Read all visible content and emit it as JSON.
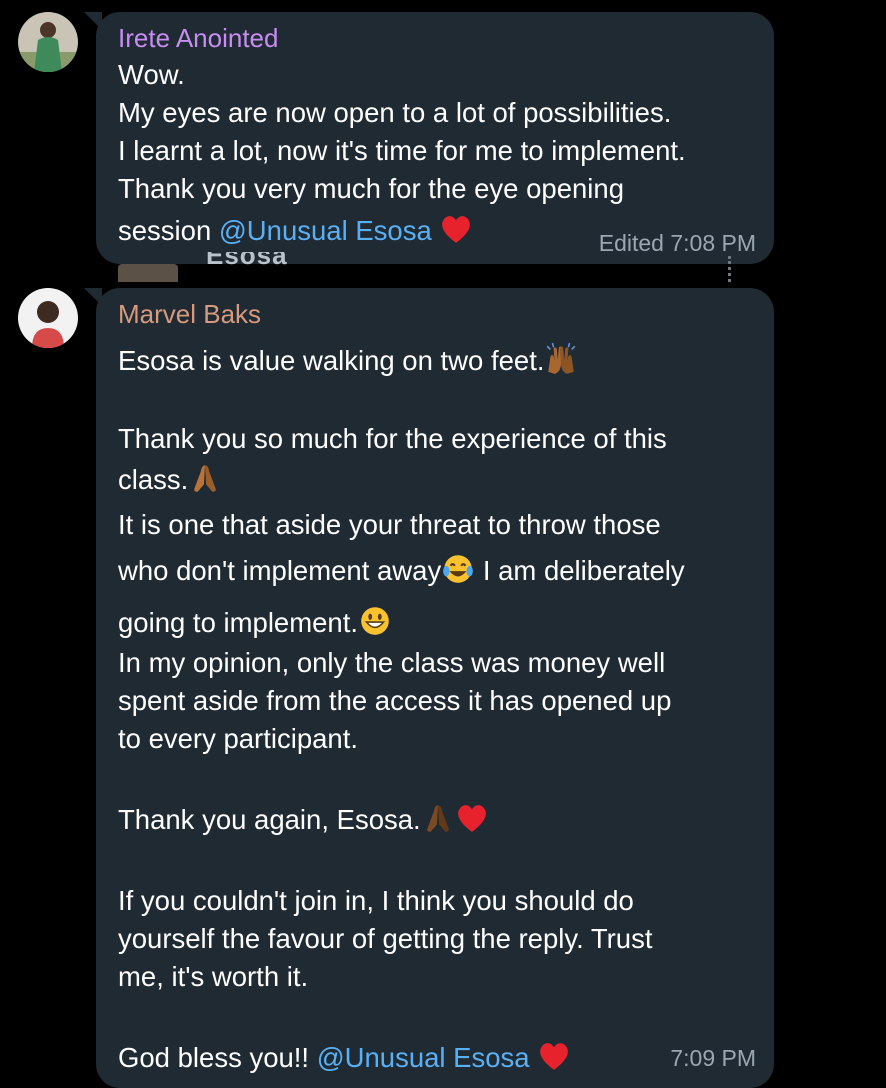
{
  "messages": [
    {
      "sender": "Irete Anointed",
      "sender_color": "#c88cf2",
      "lines": [
        "Wow.",
        "My eyes are now open to a lot of possibilities.",
        "I learnt a lot, now it's time for me to implement.",
        "Thank you very much for the eye opening",
        "session "
      ],
      "mention": "@Unusual Esosa",
      "status": "Edited 7:08 PM"
    },
    {
      "sender": "Marvel Baks",
      "sender_color": "#d79a7c",
      "lines": [
        "Esosa is value walking on two feet.",
        "",
        "Thank you so much for the experience of this",
        "class.",
        "It is one that aside your threat to throw those",
        "who don't implement away",
        " I am deliberately",
        "going to implement.",
        "In my opinion, only the class was money well",
        "spent aside from the access it has opened up",
        "to every participant.",
        "",
        "Thank you again, Esosa.",
        "",
        "If you couldn't join in, I think you should do",
        "yourself the favour of getting the reply. Trust",
        "me, it's worth it.",
        "",
        "God bless you!! "
      ],
      "mention": "@Unusual Esosa",
      "status": "7:09 PM"
    }
  ],
  "reply_peek": {
    "text": "Esosa"
  },
  "colors": {
    "background": "#000000",
    "bubble": "#1f2a33",
    "mention": "#5ab0f5",
    "time": "#9aa7b2"
  }
}
